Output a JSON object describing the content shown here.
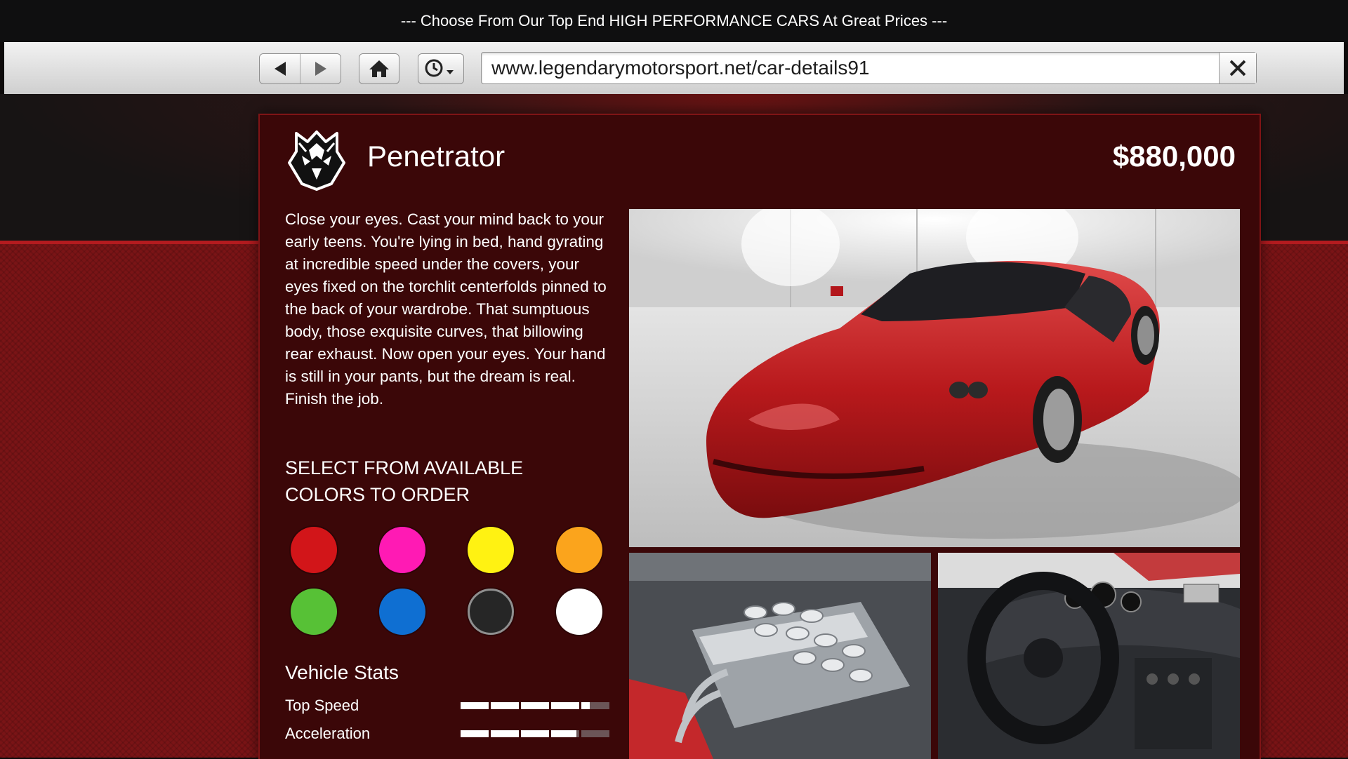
{
  "banner": {
    "text": "--- Choose From Our Top End HIGH PERFORMANCE CARS At Great Prices ---"
  },
  "browser": {
    "back_icon": "triangle-left-icon",
    "forward_icon": "triangle-right-icon",
    "home_icon": "home-icon",
    "history_icon": "clock-dropdown-icon",
    "url": "www.legendarymotorsport.net/car-details91",
    "close_icon": "close-x-icon"
  },
  "car": {
    "brand_logo": "wolf-head-logo",
    "name": "Penetrator",
    "price": "$880,000",
    "description": "Close your eyes. Cast your mind back to your early teens. You're lying in bed, hand gyrating at incredible speed under the covers, your eyes fixed on the torchlit centerfolds pinned to the back of your wardrobe. That sumptuous body, those exquisite curves, that billowing rear exhaust. Now open your eyes. Your hand is still in your pants, but the dream is real. Finish the job."
  },
  "colors": {
    "heading": "SELECT FROM AVAILABLE COLORS TO ORDER",
    "swatches": [
      "#d21519",
      "#ff1ab4",
      "#fff212",
      "#fba41c",
      "#57c136",
      "#0f6fd2",
      "#262626",
      "#ffffff"
    ],
    "selected_index": 6
  },
  "stats": {
    "heading": "Vehicle Stats",
    "items": [
      {
        "label": "Top Speed",
        "value": 0.86
      },
      {
        "label": "Acceleration",
        "value": 0.78
      }
    ]
  },
  "photos": {
    "main": "red sports car front three-quarter view in white garage",
    "engine": "engine bay with chrome intake trumpets",
    "interior": "car interior dashboard and steering wheel"
  }
}
